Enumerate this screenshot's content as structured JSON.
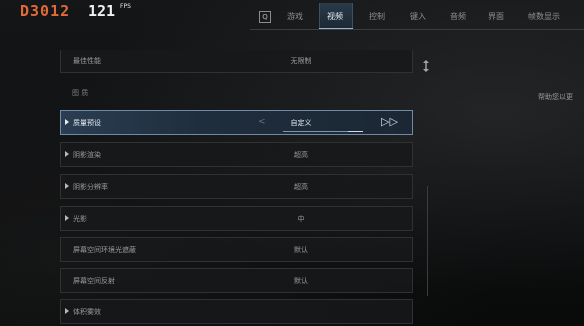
{
  "hud": {
    "code": "D3012",
    "fps_value": "121",
    "fps_label": "FPS"
  },
  "nav": {
    "icon_glyph": "Q",
    "tabs": [
      {
        "label": "游戏",
        "active": false
      },
      {
        "label": "视频",
        "active": true
      },
      {
        "label": "控制",
        "active": false
      },
      {
        "label": "键入",
        "active": false
      },
      {
        "label": "音频",
        "active": false
      },
      {
        "label": "界面",
        "active": false
      },
      {
        "label": "帧数显示",
        "active": false
      }
    ]
  },
  "settings": {
    "top_row": {
      "label": "最佳性能",
      "value": "无限制"
    },
    "section_title": "图 质",
    "rows": [
      {
        "label": "质量预设",
        "value": "自定义",
        "selected": true,
        "expandable": true
      },
      {
        "label": "阴影渲染",
        "value": "超高",
        "selected": false,
        "expandable": true
      },
      {
        "label": "阴影分辨率",
        "value": "超高",
        "selected": false,
        "expandable": true
      },
      {
        "label": "光影",
        "value": "中",
        "selected": false,
        "expandable": true
      },
      {
        "label": "屏幕空间环境光遮蔽",
        "value": "默认",
        "selected": false,
        "expandable": false
      },
      {
        "label": "屏幕空间反射",
        "value": "默认",
        "selected": false,
        "expandable": false
      },
      {
        "label": "体积雾效",
        "value": "",
        "selected": false,
        "expandable": true
      }
    ],
    "selector_left_glyph": "<",
    "selector_right_glyph": "▷▷"
  },
  "right_panel": {
    "description": "帮助您以更"
  }
}
